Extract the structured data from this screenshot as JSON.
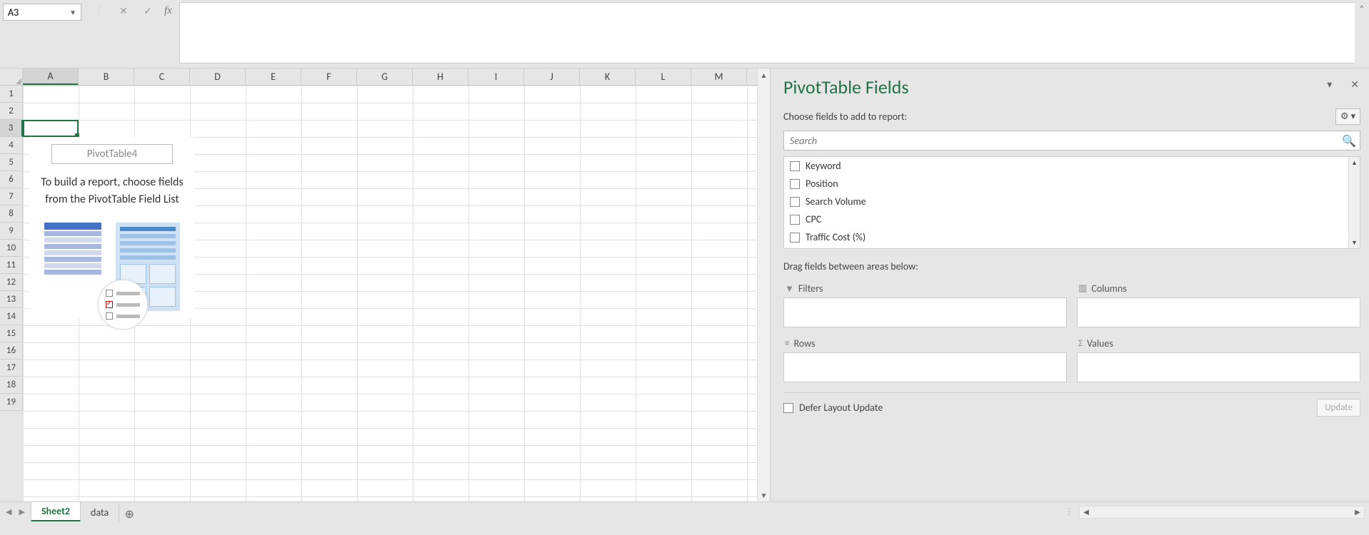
{
  "name_box": {
    "value": "A3"
  },
  "formula_bar": {
    "fx_label": "fx",
    "value": ""
  },
  "columns": [
    "A",
    "B",
    "C",
    "D",
    "E",
    "F",
    "G",
    "H",
    "I",
    "J",
    "K",
    "L",
    "M"
  ],
  "active_column": "A",
  "rows": [
    1,
    2,
    3,
    4,
    5,
    6,
    7,
    8,
    9,
    10,
    11,
    12,
    13,
    14,
    15,
    16,
    17,
    18,
    19
  ],
  "active_row": 3,
  "pivot_placeholder": {
    "name": "PivotTable4",
    "message": "To build a report, choose fields from the PivotTable Field List"
  },
  "fields_pane": {
    "title": "PivotTable Fields",
    "choose_label": "Choose fields to add to report:",
    "search_placeholder": "Search",
    "fields": [
      "Keyword",
      "Position",
      "Search Volume",
      "CPC",
      "Traffic Cost (%)"
    ],
    "drag_label": "Drag fields between areas below:",
    "areas": {
      "filters": "Filters",
      "columns": "Columns",
      "rows": "Rows",
      "values": "Values"
    },
    "defer_label": "Defer Layout Update",
    "update_label": "Update"
  },
  "tabs": {
    "sheets": [
      "Sheet2",
      "data"
    ],
    "active": "Sheet2"
  }
}
